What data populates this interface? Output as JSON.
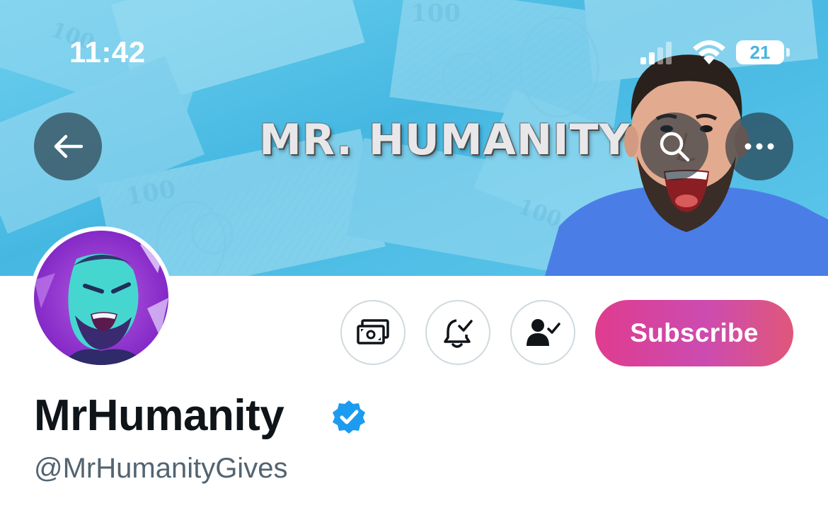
{
  "status_bar": {
    "time": "11:42",
    "battery_level": "21"
  },
  "banner": {
    "title": "MR. HUMANITY"
  },
  "nav": {
    "back_icon": "arrow-left-icon",
    "search_icon": "search-icon",
    "more_icon": "more-horizontal-icon"
  },
  "profile": {
    "display_name": "MrHumanity",
    "handle": "@MrHumanityGives",
    "verified": true
  },
  "actions": {
    "tip_icon": "money-icon",
    "notify_icon": "bell-check-icon",
    "following_icon": "person-check-icon",
    "subscribe_label": "Subscribe"
  },
  "colors": {
    "subscribe_gradient_start": "#df3c8e",
    "subscribe_gradient_end": "#e0577a",
    "verified_blue": "#1d9bf0",
    "handle_gray": "#536471",
    "name_black": "#0f1419"
  }
}
